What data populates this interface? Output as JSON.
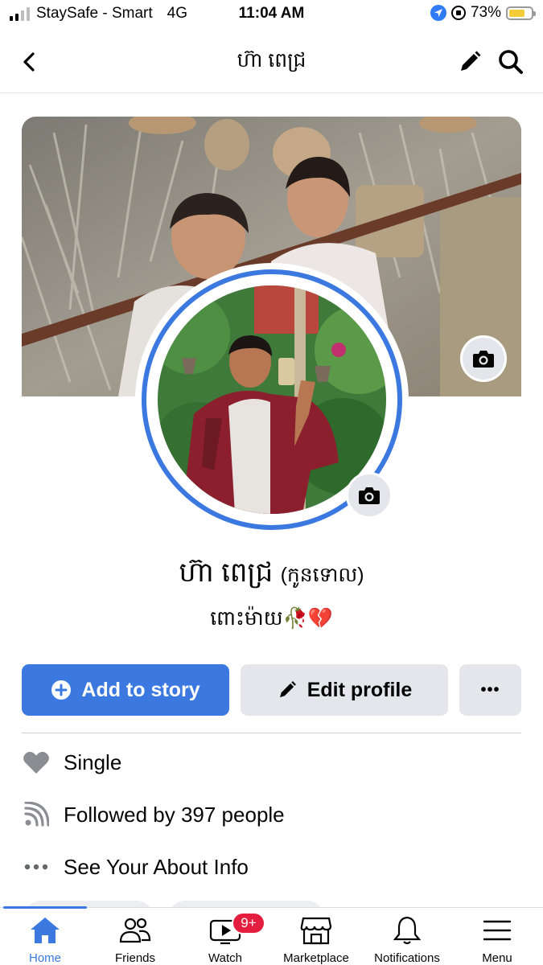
{
  "status_bar": {
    "carrier": "StaySafe - Smart",
    "network": "4G",
    "time": "11:04 AM",
    "battery_percent": "73%",
    "battery_level": 0.73
  },
  "header": {
    "title": "ហ៊ា ពេជ្រ"
  },
  "profile": {
    "name": "ហ៊ា ពេជ្រ",
    "nickname": "(កូនទោល)",
    "bio": "ពោះម៉ាយ🥀💔"
  },
  "actions": {
    "add_story_label": "Add to story",
    "edit_profile_label": "Edit profile",
    "more_label": "•••"
  },
  "info": {
    "relationship": "Single",
    "followers": "Followed by 397 people",
    "about": "See Your About Info"
  },
  "tabs": {
    "home": "Home",
    "friends": "Friends",
    "watch": "Watch",
    "watch_badge": "9+",
    "marketplace": "Marketplace",
    "notifications": "Notifications",
    "menu": "Menu"
  },
  "colors": {
    "accent": "#3b79e0",
    "badge": "#e41e3f",
    "secondary_button": "#e4e6eb"
  }
}
